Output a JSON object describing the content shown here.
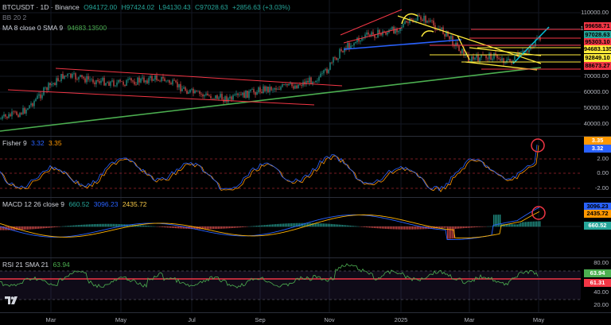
{
  "header": {
    "symbol": "BTCUSDT · 1D · Binance",
    "open": "O94172.00",
    "high": "H97424.02",
    "low": "L94130.43",
    "close": "C97028.63",
    "change": "+2856.63 (+3.03%)",
    "bb_label": "BB 20 2",
    "ma_label": "MA 8 close 0 SMA 9",
    "ma_value": "94683.13500"
  },
  "fisher": {
    "label": "Fisher 9",
    "v1": "3.32",
    "v2": "3.35"
  },
  "macd": {
    "label": "MACD 12 26 close 9",
    "v1": "660.52",
    "v2": "3096.23",
    "v3": "2435.72"
  },
  "rsi": {
    "label": "RSI 21 SMA 21",
    "v1": "63.94"
  },
  "price_axis": [
    "110000.00",
    "100000.00",
    "90000.00",
    "80000.00",
    "70000.00",
    "60000.00",
    "50000.00",
    "40000.00"
  ],
  "price_tags": [
    {
      "text": "99658.71",
      "color": "#f23645"
    },
    {
      "text": "97028.63",
      "color": "#26a69a"
    },
    {
      "text": "95303.10",
      "color": "#f23645"
    },
    {
      "text": "94683.135",
      "color": "#ffeb3b"
    },
    {
      "text": "92849.10",
      "color": "#ffeb3b"
    },
    {
      "text": "88673.27",
      "color": "#f23645"
    }
  ],
  "fisher_axis": [
    "2.00",
    "0.00",
    "-2.00"
  ],
  "fisher_tags": [
    {
      "text": "3.35",
      "color": "#ff9800"
    },
    {
      "text": "3.32",
      "color": "#2962ff"
    }
  ],
  "macd_tags": [
    {
      "text": "3096.23",
      "color": "#2962ff"
    },
    {
      "text": "2435.72",
      "color": "#ff9800"
    },
    {
      "text": "660.52",
      "color": "#26a69a"
    }
  ],
  "rsi_axis": [
    "80.00",
    "40.00",
    "20.00"
  ],
  "rsi_tags": [
    {
      "text": "63.94",
      "color": "#4caf50"
    },
    {
      "text": "61.31",
      "color": "#f23645"
    }
  ],
  "time_axis": [
    "Mar",
    "May",
    "Jul",
    "Sep",
    "Nov",
    "2025",
    "Mar",
    "May"
  ],
  "colors": {
    "up": "#26a69a",
    "down": "#ef5350",
    "trend_red": "#f23645",
    "trend_green": "#4caf50",
    "trend_yellow": "#ffeb3b",
    "trend_blue": "#2962ff",
    "trend_cyan": "#00bcd4"
  }
}
